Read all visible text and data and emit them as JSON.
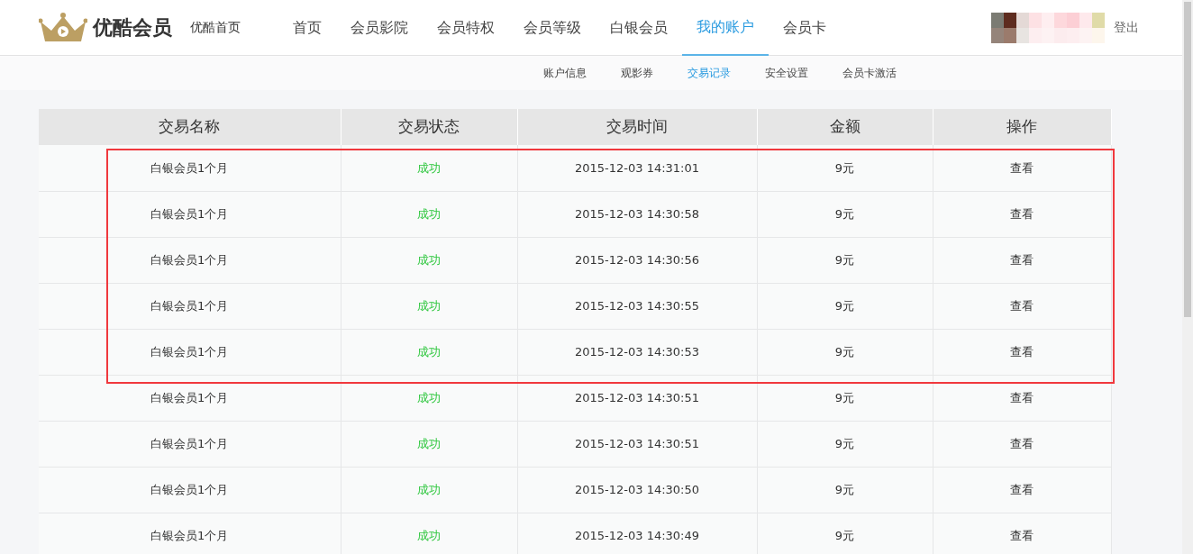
{
  "brand": {
    "name": "优酷会员",
    "home_link": "优酷首页"
  },
  "nav": [
    {
      "label": "首页",
      "selected": false
    },
    {
      "label": "会员影院",
      "selected": false
    },
    {
      "label": "会员特权",
      "selected": false
    },
    {
      "label": "会员等级",
      "selected": false
    },
    {
      "label": "白银会员",
      "selected": false
    },
    {
      "label": "我的账户",
      "selected": true
    },
    {
      "label": "会员卡",
      "selected": false
    }
  ],
  "user": {
    "logout": "登出"
  },
  "subnav": [
    {
      "label": "账户信息",
      "selected": false
    },
    {
      "label": "观影券",
      "selected": false
    },
    {
      "label": "交易记录",
      "selected": true
    },
    {
      "label": "安全设置",
      "selected": false
    },
    {
      "label": "会员卡激活",
      "selected": false
    }
  ],
  "table": {
    "columns": [
      "交易名称",
      "交易状态",
      "交易时间",
      "金额",
      "操作"
    ],
    "rows": [
      {
        "name": "白银会员1个月",
        "status": "成功",
        "time": "2015-12-03 14:31:01",
        "amount": "9元",
        "action": "查看",
        "highlighted": true
      },
      {
        "name": "白银会员1个月",
        "status": "成功",
        "time": "2015-12-03 14:30:58",
        "amount": "9元",
        "action": "查看",
        "highlighted": true
      },
      {
        "name": "白银会员1个月",
        "status": "成功",
        "time": "2015-12-03 14:30:56",
        "amount": "9元",
        "action": "查看",
        "highlighted": true
      },
      {
        "name": "白银会员1个月",
        "status": "成功",
        "time": "2015-12-03 14:30:55",
        "amount": "9元",
        "action": "查看",
        "highlighted": true
      },
      {
        "name": "白银会员1个月",
        "status": "成功",
        "time": "2015-12-03 14:30:53",
        "amount": "9元",
        "action": "查看",
        "highlighted": true
      },
      {
        "name": "白银会员1个月",
        "status": "成功",
        "time": "2015-12-03 14:30:51",
        "amount": "9元",
        "action": "查看",
        "highlighted": false
      },
      {
        "name": "白银会员1个月",
        "status": "成功",
        "time": "2015-12-03 14:30:51",
        "amount": "9元",
        "action": "查看",
        "highlighted": false
      },
      {
        "name": "白银会员1个月",
        "status": "成功",
        "time": "2015-12-03 14:30:50",
        "amount": "9元",
        "action": "查看",
        "highlighted": false
      },
      {
        "name": "白银会员1个月",
        "status": "成功",
        "time": "2015-12-03 14:30:49",
        "amount": "9元",
        "action": "查看",
        "highlighted": false
      }
    ]
  }
}
